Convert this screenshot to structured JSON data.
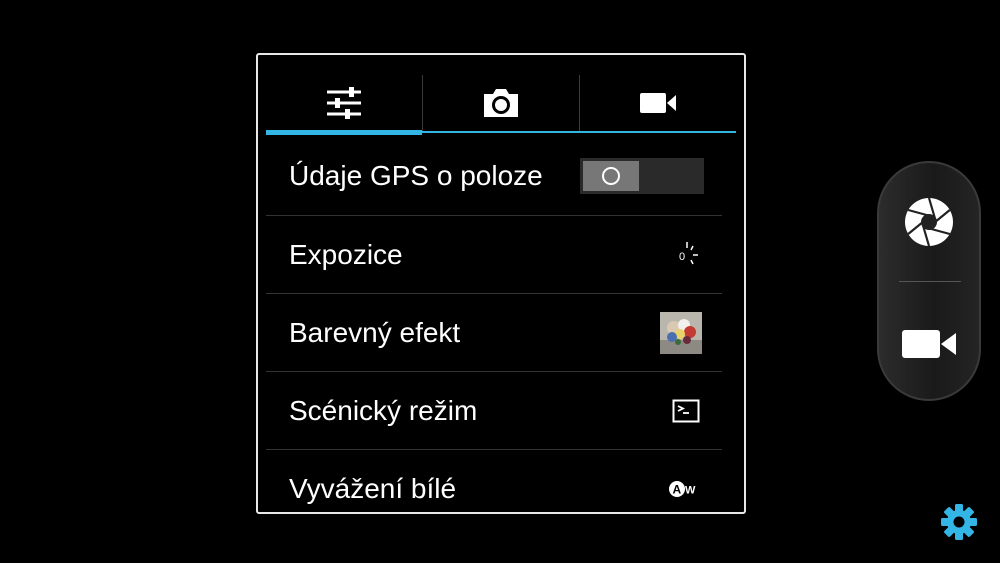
{
  "settings_panel": {
    "tabs": [
      {
        "icon": "sliders-icon",
        "active": true
      },
      {
        "icon": "camera-icon",
        "active": false
      },
      {
        "icon": "video-camera-icon",
        "active": false
      }
    ],
    "items": [
      {
        "label": "Údaje GPS o poloze",
        "control": "toggle",
        "toggle_on": false
      },
      {
        "label": "Expozice",
        "control": "exposure-icon",
        "value": "0"
      },
      {
        "label": "Barevný efekt",
        "control": "color-effect-thumbnail"
      },
      {
        "label": "Scénický režim",
        "control": "scene-mode-icon"
      },
      {
        "label": "Vyvážení bílé",
        "control": "white-balance-auto-icon",
        "value": "AW"
      }
    ]
  },
  "mode_switcher": {
    "items": [
      {
        "icon": "shutter-icon"
      },
      {
        "icon": "video-camera-icon"
      }
    ]
  },
  "settings_button": {
    "icon": "gear-icon"
  },
  "colors": {
    "accent": "#33b5e5",
    "panel_border": "#e8e8e8",
    "gear": "#33b5e5"
  }
}
